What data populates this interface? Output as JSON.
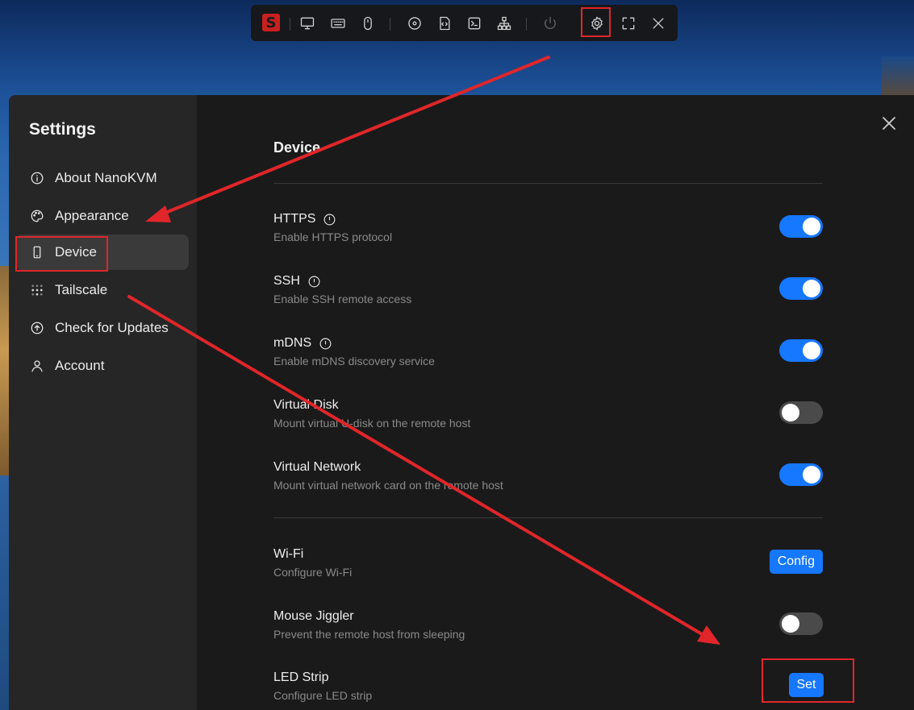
{
  "toolbar": {
    "logo_text": "S",
    "items": [
      {
        "name": "screen-icon"
      },
      {
        "name": "keyboard-icon"
      },
      {
        "name": "mouse-icon"
      },
      {
        "name": "disc-icon"
      },
      {
        "name": "script-icon"
      },
      {
        "name": "terminal-icon"
      },
      {
        "name": "network-icon"
      },
      {
        "name": "power-icon"
      },
      {
        "name": "settings-gear-icon"
      },
      {
        "name": "fullscreen-icon"
      },
      {
        "name": "close-icon"
      }
    ]
  },
  "sidebar": {
    "title": "Settings",
    "items": [
      {
        "label": "About NanoKVM",
        "icon": "info-icon"
      },
      {
        "label": "Appearance",
        "icon": "palette-icon"
      },
      {
        "label": "Device",
        "icon": "device-icon",
        "active": true
      },
      {
        "label": "Tailscale",
        "icon": "tailscale-icon"
      },
      {
        "label": "Check for Updates",
        "icon": "upload-circle-icon"
      },
      {
        "label": "Account",
        "icon": "user-icon"
      }
    ]
  },
  "content": {
    "section_title": "Device",
    "settings": [
      {
        "title": "HTTPS",
        "description": "Enable HTTPS protocol",
        "control": "toggle",
        "on": true,
        "info": true
      },
      {
        "title": "SSH",
        "description": "Enable SSH remote access",
        "control": "toggle",
        "on": true,
        "info": true
      },
      {
        "title": "mDNS",
        "description": "Enable mDNS discovery service",
        "control": "toggle",
        "on": true,
        "info": true
      },
      {
        "title": "Virtual Disk",
        "description": "Mount virtual U-disk on the remote host",
        "control": "toggle",
        "on": false
      },
      {
        "title": "Virtual Network",
        "description": "Mount virtual network card on the remote host",
        "control": "toggle",
        "on": true
      },
      {
        "title": "Wi-Fi",
        "description": "Configure Wi-Fi",
        "control": "button",
        "button_label": "Config"
      },
      {
        "title": "Mouse Jiggler",
        "description": "Prevent the remote host from sleeping",
        "control": "toggle",
        "on": false
      },
      {
        "title": "LED Strip",
        "description": "Configure LED strip",
        "control": "button",
        "button_label": "Set"
      }
    ]
  },
  "colors": {
    "accent": "#1677ff",
    "annotation": "#e0262a"
  }
}
